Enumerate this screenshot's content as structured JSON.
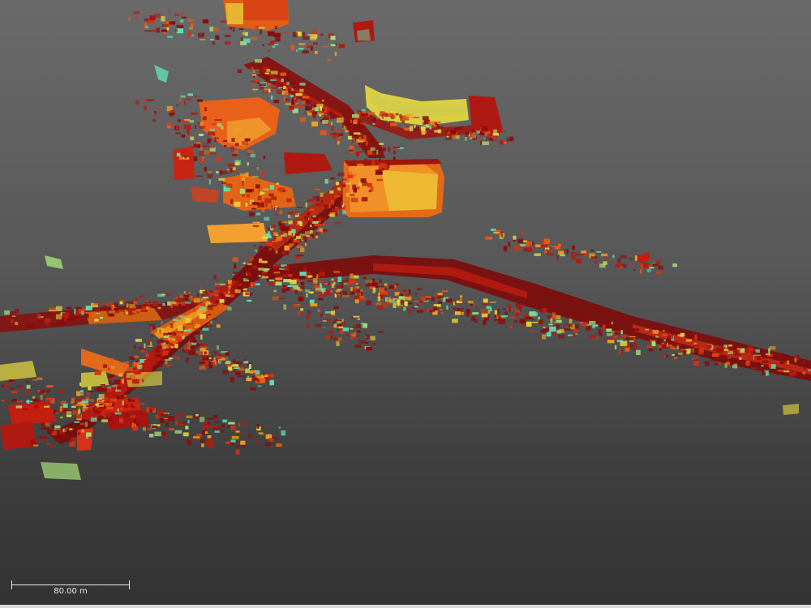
{
  "viewer": {
    "background_top": "#6a6a6a",
    "background_bottom": "#323232",
    "scale_bar": {
      "label": "80.00 m"
    },
    "palette": [
      "#8b0a0a",
      "#b51a10",
      "#d83214",
      "#ee5a12",
      "#f5a21e",
      "#eadc3c",
      "#a6e07a",
      "#5fe0b2"
    ]
  }
}
